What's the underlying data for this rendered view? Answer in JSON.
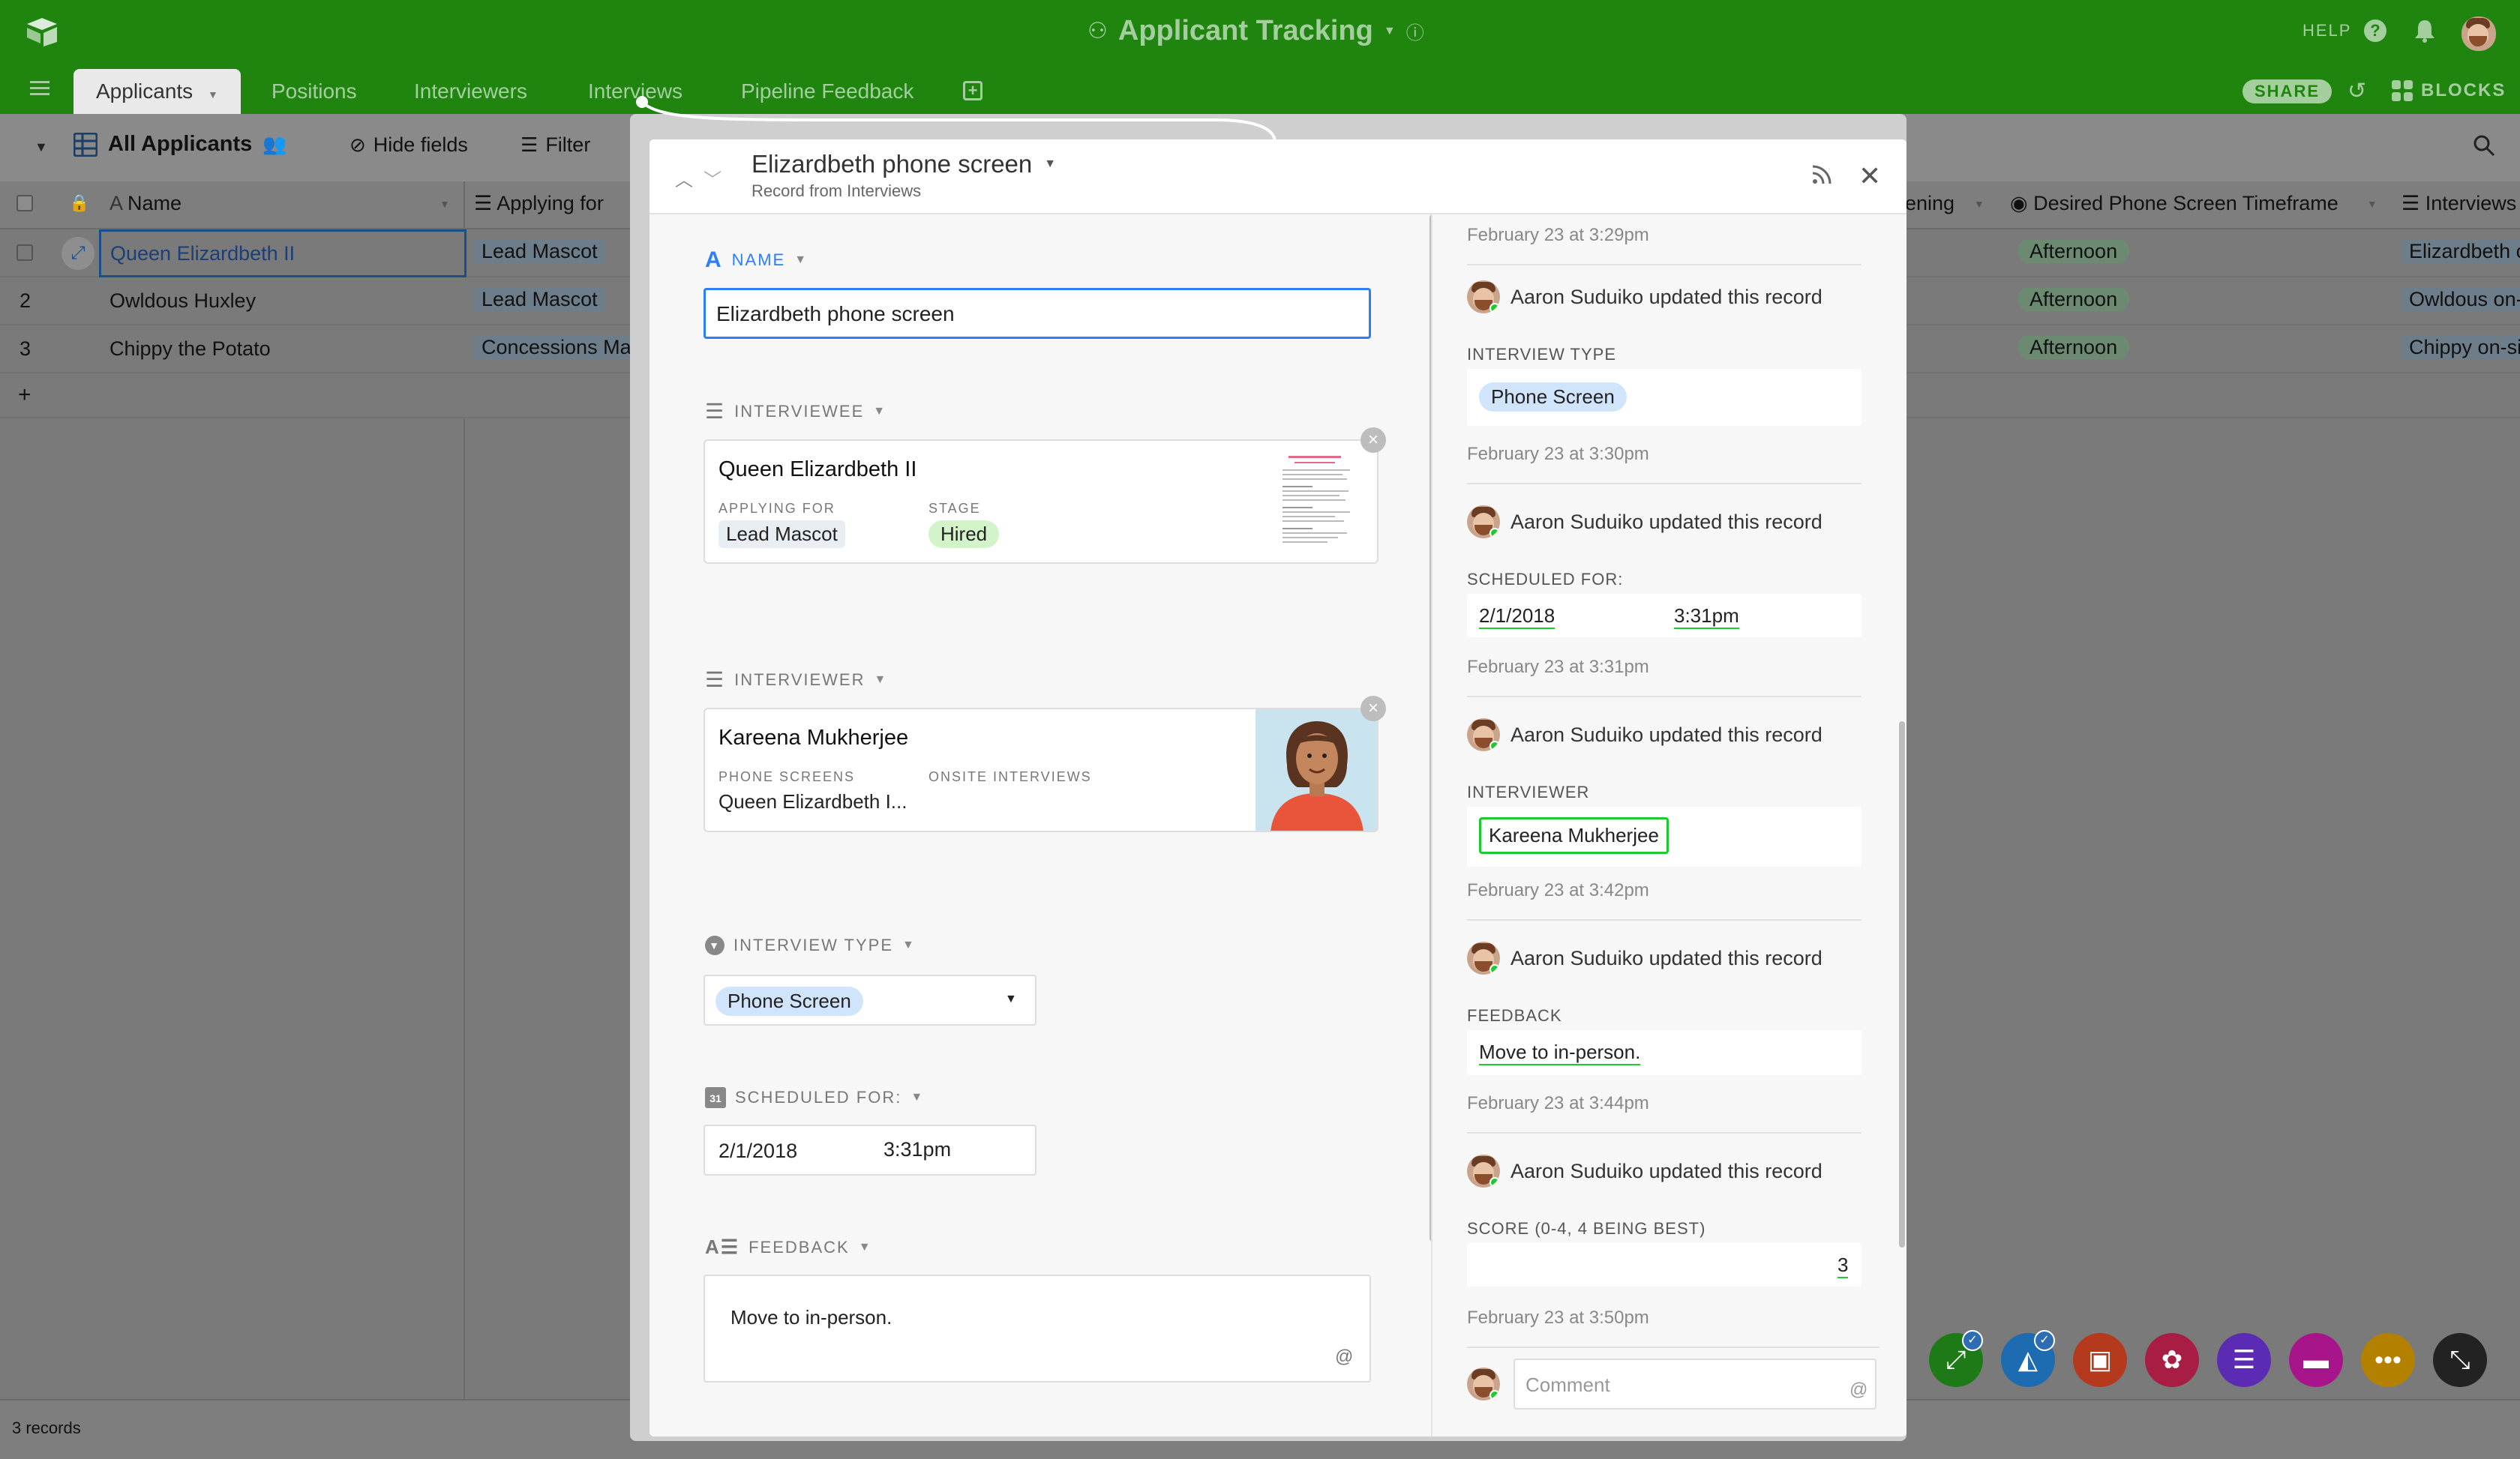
{
  "app": {
    "title": "Applicant Tracking",
    "help": "HELP",
    "share": "SHARE",
    "blocks": "BLOCKS",
    "brand_color": "#1f850f"
  },
  "tabs": [
    {
      "label": "Applicants",
      "active": true
    },
    {
      "label": "Positions"
    },
    {
      "label": "Interviewers"
    },
    {
      "label": "Interviews"
    },
    {
      "label": "Pipeline Feedback"
    }
  ],
  "viewbar": {
    "view_name": "All Applicants",
    "hide_fields": "Hide fields",
    "filter": "Filter"
  },
  "grid": {
    "columns": [
      "Name",
      "Applying for",
      "ening",
      "Desired Phone Screen Timeframe",
      "Interviews"
    ],
    "rows": [
      {
        "num": "",
        "name": "Queen Elizardbeth II",
        "applying": "Lead Mascot",
        "timeframe": "Afternoon",
        "interviews": "Elizardbeth c"
      },
      {
        "num": "2",
        "name": "Owldous Huxley",
        "applying": "Lead Mascot",
        "timeframe": "Afternoon",
        "interviews": "Owldous on-"
      },
      {
        "num": "3",
        "name": "Chippy the Potato",
        "applying": "Concessions Mas",
        "timeframe": "Afternoon",
        "interviews": "Chippy on-si"
      }
    ],
    "add_row": "+",
    "record_count": "3 records"
  },
  "record": {
    "title": "Elizardbeth phone screen",
    "subtitle": "Record from Interviews",
    "fields": {
      "name": {
        "label": "NAME",
        "value": "Elizardbeth phone screen"
      },
      "interviewee": {
        "label": "INTERVIEWEE",
        "name": "Queen Elizardbeth II",
        "applying_label": "APPLYING FOR",
        "applying_value": "Lead Mascot",
        "stage_label": "STAGE",
        "stage_value": "Hired"
      },
      "interviewer": {
        "label": "INTERVIEWER",
        "name": "Kareena Mukherjee",
        "phone_label": "PHONE SCREENS",
        "phone_value": "Queen Elizardbeth I...",
        "onsite_label": "ONSITE INTERVIEWS"
      },
      "interview_type": {
        "label": "INTERVIEW TYPE",
        "value": "Phone Screen"
      },
      "scheduled": {
        "label": "SCHEDULED FOR:",
        "date": "2/1/2018",
        "time": "3:31pm"
      },
      "feedback": {
        "label": "FEEDBACK",
        "value": "Move to in-person.",
        "at": "@"
      }
    }
  },
  "activity": {
    "top_timestamp": "February 23 at 3:29pm",
    "items": [
      {
        "who": "Aaron Suduiko updated this record",
        "field": "INTERVIEW TYPE",
        "value": "Phone Screen",
        "time": "February 23 at 3:30pm"
      },
      {
        "who": "Aaron Suduiko updated this record",
        "field": "SCHEDULED FOR:",
        "date": "2/1/2018",
        "value_time": "3:31pm",
        "time": "February 23 at 3:31pm"
      },
      {
        "who": "Aaron Suduiko updated this record",
        "field": "INTERVIEWER",
        "value": "Kareena Mukherjee",
        "time": "February 23 at 3:42pm"
      },
      {
        "who": "Aaron Suduiko updated this record",
        "field": "FEEDBACK",
        "value": "Move to in-person.",
        "time": "February 23 at 3:44pm"
      },
      {
        "who": "Aaron Suduiko updated this record",
        "field": "SCORE (0-4, 4 BEING BEST)",
        "value": "3",
        "time": "February 23 at 3:50pm"
      }
    ],
    "comment_placeholder": "Comment",
    "comment_at": "@"
  },
  "fab_colors": [
    "#20c933",
    "#2d7ff9",
    "#f82b60",
    "#f82b60",
    "#8b46ff",
    "#ff08c2",
    "#fcb400",
    "#333333"
  ]
}
